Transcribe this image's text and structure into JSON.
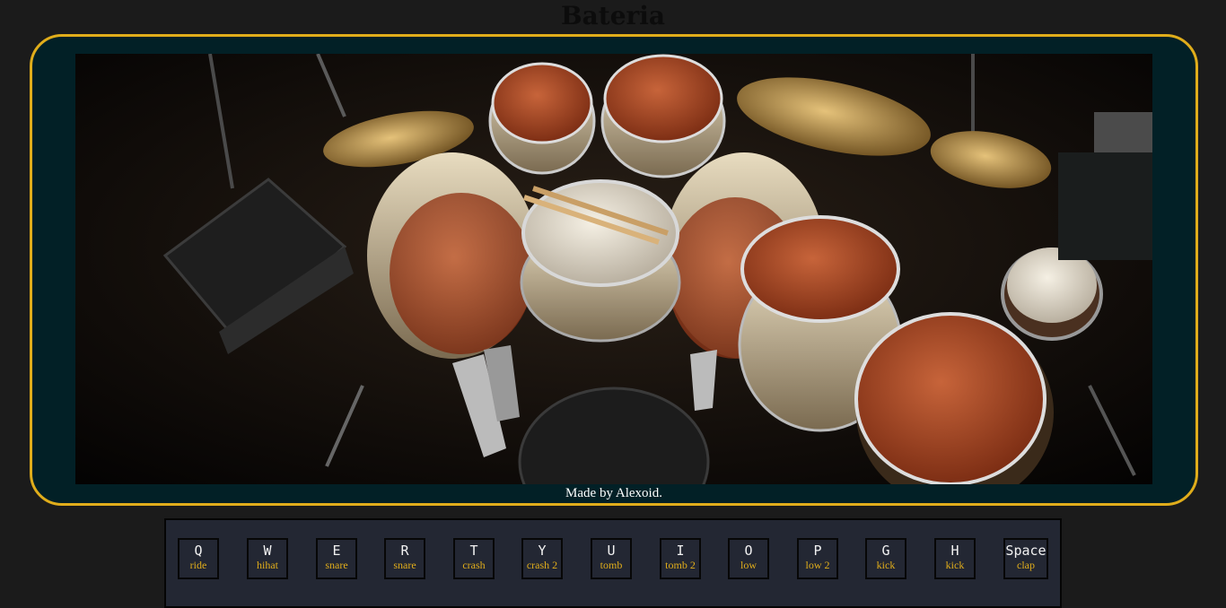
{
  "header": {
    "title": "Bateria"
  },
  "footer": {
    "credit": "Made by Alexoid."
  },
  "colors": {
    "page_background": "#1b1b1b",
    "stage_background": "#022026",
    "stage_border": "#e0ad1b",
    "panel_background": "#232733",
    "key_letter": "#f1f1f1",
    "key_sound": "#e0ad1b"
  },
  "keys": [
    {
      "letter": "Q",
      "sound": "ride"
    },
    {
      "letter": "W",
      "sound": "hihat"
    },
    {
      "letter": "E",
      "sound": "snare"
    },
    {
      "letter": "R",
      "sound": "snare"
    },
    {
      "letter": "T",
      "sound": "crash"
    },
    {
      "letter": "Y",
      "sound": "crash 2"
    },
    {
      "letter": "U",
      "sound": "tomb"
    },
    {
      "letter": "I",
      "sound": "tomb 2"
    },
    {
      "letter": "O",
      "sound": "low"
    },
    {
      "letter": "P",
      "sound": "low 2"
    },
    {
      "letter": "G",
      "sound": "kick"
    },
    {
      "letter": "H",
      "sound": "kick"
    },
    {
      "letter": "Space",
      "sound": "clap"
    }
  ]
}
